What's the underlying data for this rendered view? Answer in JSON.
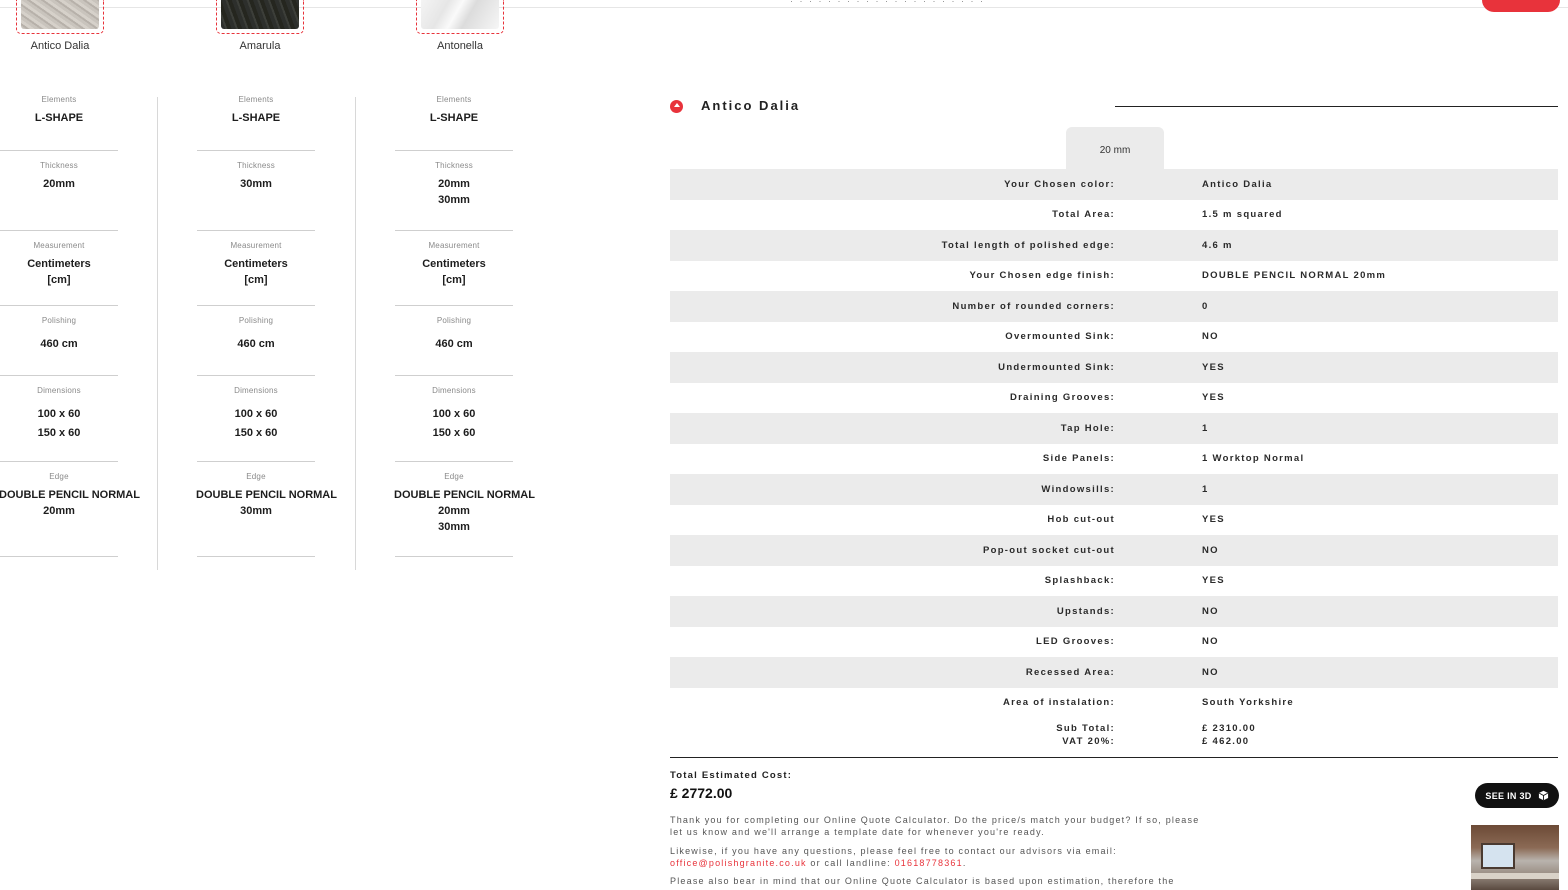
{
  "top_cut_text": "· · · · · · · · · · · · · · · · · · · · ·",
  "swatches": [
    {
      "name": "Antico Dalia"
    },
    {
      "name": "Amarula"
    },
    {
      "name": "Antonella"
    }
  ],
  "columns": [
    {
      "elements_label": "Elements",
      "elements": "L-SHAPE",
      "thickness_label": "Thickness",
      "thickness": [
        "20mm"
      ],
      "measurement_label": "Measurement",
      "measurement": [
        "Centimeters",
        "[cm]"
      ],
      "polishing_label": "Polishing",
      "polishing": "460 cm",
      "dimensions_label": "Dimensions",
      "dimensions": [
        "100 x 60",
        "150 x 60"
      ],
      "edge_label": "Edge",
      "edge": [
        "DOUBLE PENCIL NORMAL",
        "20mm"
      ]
    },
    {
      "elements_label": "Elements",
      "elements": "L-SHAPE",
      "thickness_label": "Thickness",
      "thickness": [
        "30mm"
      ],
      "measurement_label": "Measurement",
      "measurement": [
        "Centimeters",
        "[cm]"
      ],
      "polishing_label": "Polishing",
      "polishing": "460 cm",
      "dimensions_label": "Dimensions",
      "dimensions": [
        "100 x 60",
        "150 x 60"
      ],
      "edge_label": "Edge",
      "edge": [
        "DOUBLE PENCIL NORMAL",
        "30mm"
      ]
    },
    {
      "elements_label": "Elements",
      "elements": "L-SHAPE",
      "thickness_label": "Thickness",
      "thickness": [
        "20mm",
        "30mm"
      ],
      "measurement_label": "Measurement",
      "measurement": [
        "Centimeters",
        "[cm]"
      ],
      "polishing_label": "Polishing",
      "polishing": "460 cm",
      "dimensions_label": "Dimensions",
      "dimensions": [
        "100 x 60",
        "150 x 60"
      ],
      "edge_label": "Edge",
      "edge": [
        "DOUBLE PENCIL NORMAL",
        "20mm",
        "30mm"
      ]
    }
  ],
  "quote": {
    "stone_name": "Antico Dalia",
    "tab": "20 mm",
    "rows": [
      {
        "k": "Your Chosen color:",
        "v": "Antico Dalia"
      },
      {
        "k": "Total Area:",
        "v": "1.5   m squared"
      },
      {
        "k": "Total length of polished edge:",
        "v": "4.6   m"
      },
      {
        "k": "Your Chosen edge finish:",
        "v": "DOUBLE PENCIL NORMAL   20mm"
      },
      {
        "k": "Number of rounded corners:",
        "v": "0"
      },
      {
        "k": "Overmounted Sink:",
        "v": "NO"
      },
      {
        "k": "Undermounted Sink:",
        "v": "YES"
      },
      {
        "k": "Draining Grooves:",
        "v": "YES"
      },
      {
        "k": "Tap Hole:",
        "v": "1"
      },
      {
        "k": "Side Panels:",
        "v": "1   Worktop Normal"
      },
      {
        "k": "Windowsills:",
        "v": "1"
      },
      {
        "k": "Hob cut-out",
        "v": "YES"
      },
      {
        "k": "Pop-out socket cut-out",
        "v": "NO"
      },
      {
        "k": "Splashback:",
        "v": "YES"
      },
      {
        "k": "Upstands:",
        "v": "NO"
      },
      {
        "k": "LED Grooves:",
        "v": "NO"
      },
      {
        "k": "Recessed Area:",
        "v": "NO"
      },
      {
        "k": "Area of instalation:",
        "v": "South Yorkshire"
      }
    ],
    "subtotal_label": "Sub Total:",
    "subtotal_value": "£ 2310.00",
    "vat_label": "VAT 20%:",
    "vat_value": "£ 462.00",
    "total_label": "Total Estimated Cost:",
    "total_value": "£ 2772.00",
    "note1": "Thank you for completing our Online Quote Calculator. Do the price/s match your budget? If so, please let us know and we'll arrange a template date for whenever you're ready.",
    "note2_prefix": "Likewise, if you have any questions, please feel free to contact our advisors via email:",
    "email": "office@polishgranite.co.uk",
    "note2_mid": " or call landline: ",
    "phone": "01618778361",
    "note2_end": ".",
    "note3": "Please also bear in mind that our Online Quote Calculator is based upon estimation, therefore the"
  },
  "see3d_label": "SEE IN 3D",
  "colors": {
    "accent": "#e8333b",
    "row_shade": "#ebebeb"
  }
}
